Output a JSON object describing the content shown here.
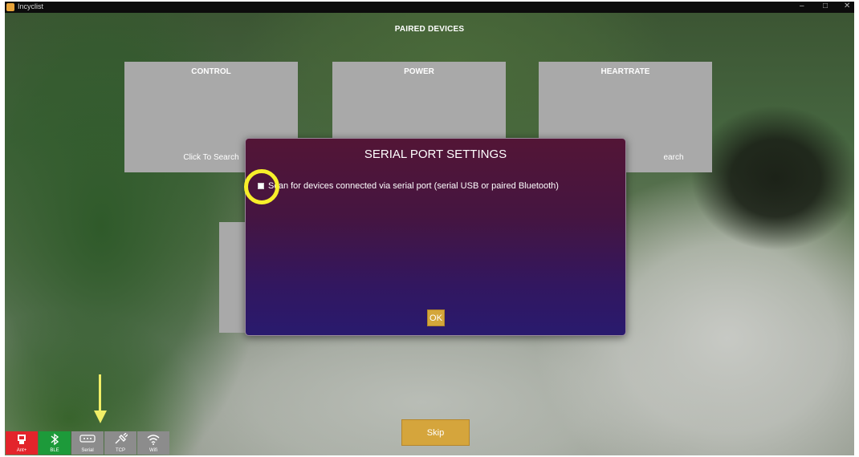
{
  "window": {
    "title": "Incyclist",
    "controls": [
      "–",
      "□",
      "✕"
    ]
  },
  "page": {
    "title": "PAIRED DEVICES"
  },
  "tiles": [
    {
      "title": "CONTROL",
      "hint": "Click To Search"
    },
    {
      "title": "POWER",
      "hint": ""
    },
    {
      "title": "HEARTRATE",
      "hint": "earch"
    }
  ],
  "modal": {
    "title": "SERIAL PORT SETTINGS",
    "scan_label": "Scan for devices connected via serial port (serial USB or paired Bluetooth)",
    "scan_checked": false,
    "ok_label": "OK"
  },
  "skip_label": "Skip",
  "toolbar": [
    {
      "label": "Ant+",
      "icon": "ant-usb-icon",
      "color": "#e3242b"
    },
    {
      "label": "BLE",
      "icon": "bluetooth-icon",
      "color": "#1d9a3a"
    },
    {
      "label": "Serial",
      "icon": "serial-port-icon",
      "color": "#8c8c8c"
    },
    {
      "label": "TCP",
      "icon": "tcp-plug-icon",
      "color": "#8c8c8c"
    },
    {
      "label": "Wifi",
      "icon": "wifi-icon",
      "color": "#8c8c8c"
    }
  ],
  "annotations": {
    "highlight_color": "#f7ef2a"
  }
}
